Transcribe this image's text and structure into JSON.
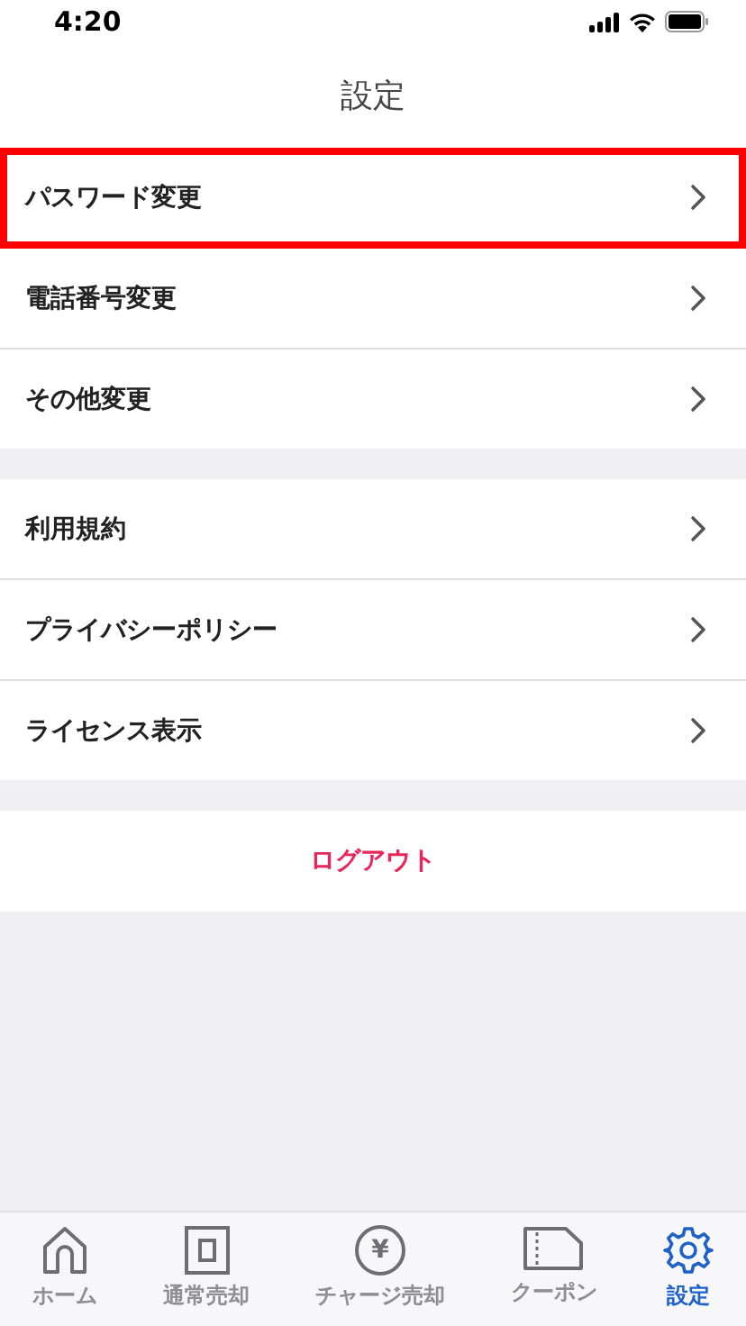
{
  "status_bar": {
    "time": "4:20"
  },
  "header": {
    "title": "設定"
  },
  "sections": [
    {
      "items": [
        {
          "label": "パスワード変更",
          "highlighted": true
        },
        {
          "label": "電話番号変更",
          "highlighted": false
        },
        {
          "label": "その他変更",
          "highlighted": false
        }
      ]
    },
    {
      "items": [
        {
          "label": "利用規約",
          "highlighted": false
        },
        {
          "label": "プライバシーポリシー",
          "highlighted": false
        },
        {
          "label": "ライセンス表示",
          "highlighted": false
        }
      ]
    }
  ],
  "logout": {
    "label": "ログアウト"
  },
  "tab_bar": [
    {
      "kind": "home",
      "label": "ホーム",
      "selected": false
    },
    {
      "kind": "square",
      "label": "通常売却",
      "selected": false
    },
    {
      "kind": "yen",
      "label": "チャージ売却",
      "glyph": "¥",
      "selected": false
    },
    {
      "kind": "ticket",
      "label": "クーポン",
      "selected": false
    },
    {
      "kind": "gear",
      "label": "設定",
      "selected": true
    }
  ]
}
